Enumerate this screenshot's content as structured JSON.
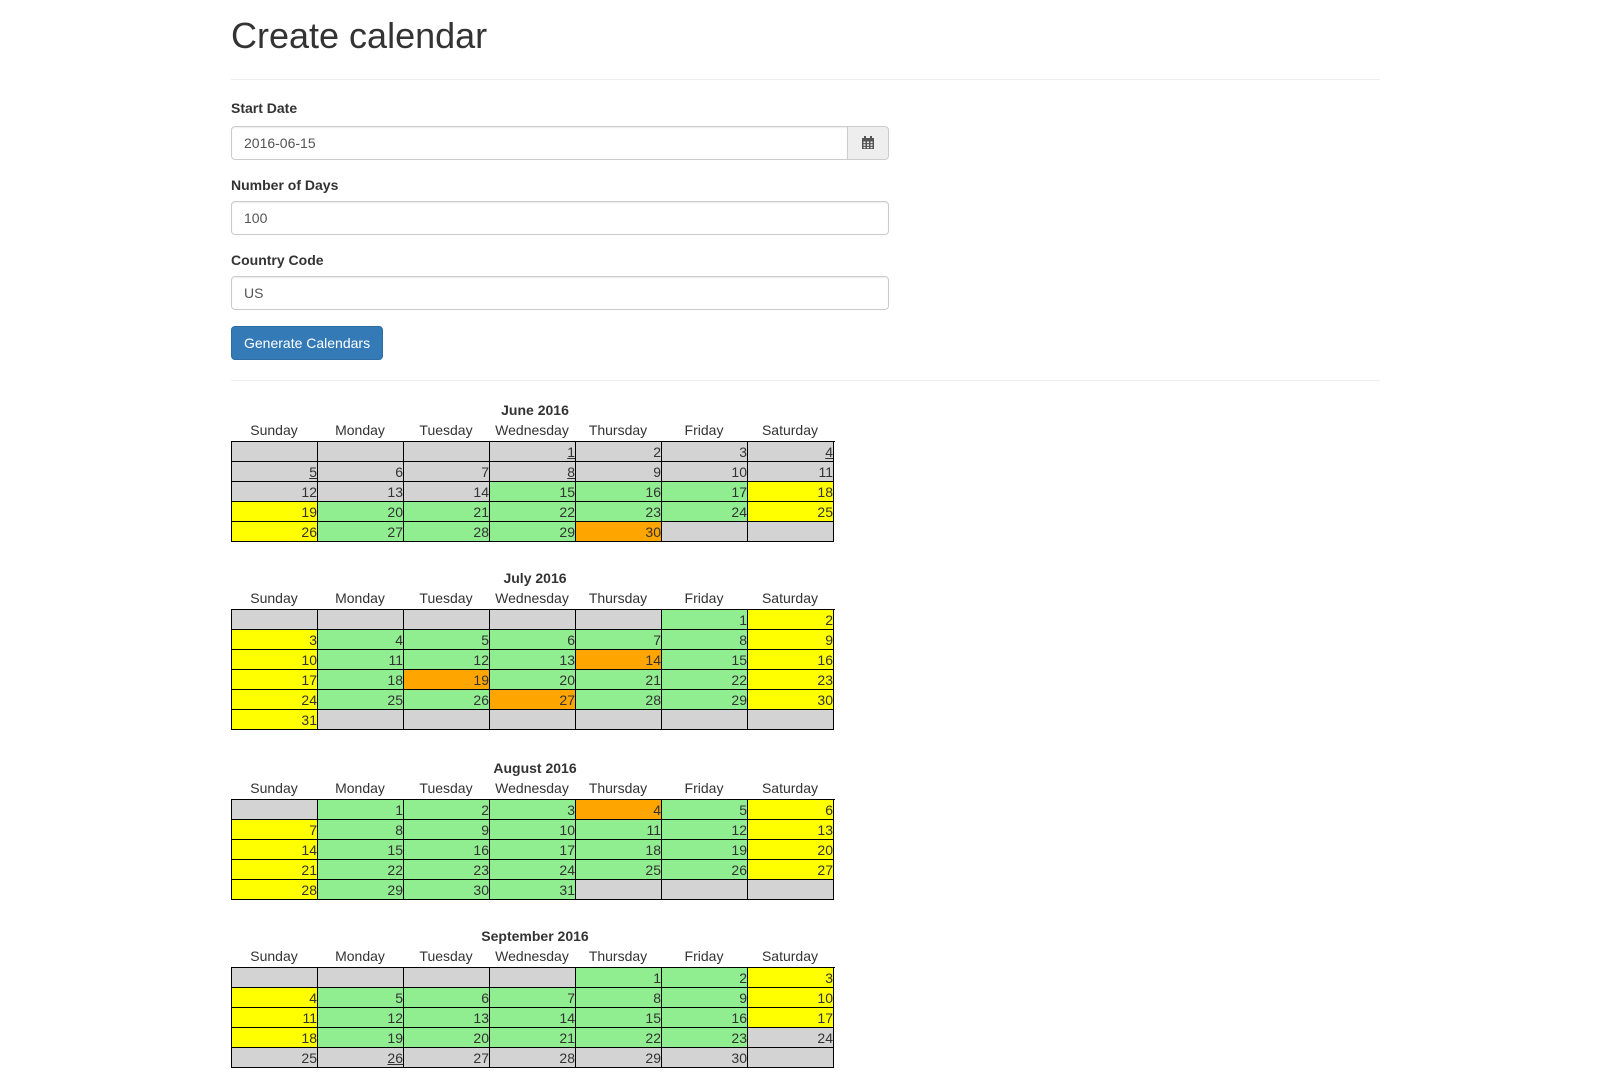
{
  "page": {
    "title": "Create calendar"
  },
  "form": {
    "start_date": {
      "label": "Start Date",
      "value": "2016-06-15"
    },
    "num_days": {
      "label": "Number of Days",
      "value": "100"
    },
    "country_code": {
      "label": "Country Code",
      "value": "US"
    },
    "submit_label": "Generate Calendars"
  },
  "day_names": [
    "Sunday",
    "Monday",
    "Tuesday",
    "Wednesday",
    "Thursday",
    "Friday",
    "Saturday"
  ],
  "colors": {
    "g": "#d3d3d3",
    "w": "#90ee90",
    "y": "#ffff00",
    "o": "#ffa500",
    "primary": "#337ab7"
  },
  "calendars": [
    {
      "title": "June 2016",
      "weeks": [
        [
          {
            "c": "g"
          },
          {
            "c": "g"
          },
          {
            "c": "g"
          },
          {
            "d": "1",
            "c": "g",
            "u": true
          },
          {
            "d": "2",
            "c": "g"
          },
          {
            "d": "3",
            "c": "g"
          },
          {
            "d": "4",
            "c": "g",
            "u": true
          }
        ],
        [
          {
            "d": "5",
            "c": "g",
            "u": true
          },
          {
            "d": "6",
            "c": "g"
          },
          {
            "d": "7",
            "c": "g"
          },
          {
            "d": "8",
            "c": "g",
            "u": true
          },
          {
            "d": "9",
            "c": "g"
          },
          {
            "d": "10",
            "c": "g"
          },
          {
            "d": "11",
            "c": "g"
          }
        ],
        [
          {
            "d": "12",
            "c": "g"
          },
          {
            "d": "13",
            "c": "g"
          },
          {
            "d": "14",
            "c": "g"
          },
          {
            "d": "15",
            "c": "w"
          },
          {
            "d": "16",
            "c": "w"
          },
          {
            "d": "17",
            "c": "w"
          },
          {
            "d": "18",
            "c": "y"
          }
        ],
        [
          {
            "d": "19",
            "c": "y"
          },
          {
            "d": "20",
            "c": "w"
          },
          {
            "d": "21",
            "c": "w"
          },
          {
            "d": "22",
            "c": "w"
          },
          {
            "d": "23",
            "c": "w"
          },
          {
            "d": "24",
            "c": "w"
          },
          {
            "d": "25",
            "c": "y"
          }
        ],
        [
          {
            "d": "26",
            "c": "y"
          },
          {
            "d": "27",
            "c": "w"
          },
          {
            "d": "28",
            "c": "w"
          },
          {
            "d": "29",
            "c": "w"
          },
          {
            "d": "30",
            "c": "o"
          },
          {
            "c": "g"
          },
          {
            "c": "g"
          }
        ]
      ]
    },
    {
      "title": "July 2016",
      "weeks": [
        [
          {
            "c": "g"
          },
          {
            "c": "g"
          },
          {
            "c": "g"
          },
          {
            "c": "g"
          },
          {
            "c": "g"
          },
          {
            "d": "1",
            "c": "w"
          },
          {
            "d": "2",
            "c": "y"
          }
        ],
        [
          {
            "d": "3",
            "c": "y"
          },
          {
            "d": "4",
            "c": "w"
          },
          {
            "d": "5",
            "c": "w"
          },
          {
            "d": "6",
            "c": "w"
          },
          {
            "d": "7",
            "c": "w"
          },
          {
            "d": "8",
            "c": "w"
          },
          {
            "d": "9",
            "c": "y"
          }
        ],
        [
          {
            "d": "10",
            "c": "y"
          },
          {
            "d": "11",
            "c": "w"
          },
          {
            "d": "12",
            "c": "w"
          },
          {
            "d": "13",
            "c": "w"
          },
          {
            "d": "14",
            "c": "o"
          },
          {
            "d": "15",
            "c": "w"
          },
          {
            "d": "16",
            "c": "y"
          }
        ],
        [
          {
            "d": "17",
            "c": "y"
          },
          {
            "d": "18",
            "c": "w"
          },
          {
            "d": "19",
            "c": "o"
          },
          {
            "d": "20",
            "c": "w"
          },
          {
            "d": "21",
            "c": "w"
          },
          {
            "d": "22",
            "c": "w"
          },
          {
            "d": "23",
            "c": "y"
          }
        ],
        [
          {
            "d": "24",
            "c": "y"
          },
          {
            "d": "25",
            "c": "w"
          },
          {
            "d": "26",
            "c": "w"
          },
          {
            "d": "27",
            "c": "o"
          },
          {
            "d": "28",
            "c": "w"
          },
          {
            "d": "29",
            "c": "w"
          },
          {
            "d": "30",
            "c": "y"
          }
        ],
        [
          {
            "d": "31",
            "c": "y"
          },
          {
            "c": "g"
          },
          {
            "c": "g"
          },
          {
            "c": "g"
          },
          {
            "c": "g"
          },
          {
            "c": "g"
          },
          {
            "c": "g"
          }
        ]
      ]
    },
    {
      "title": "August 2016",
      "weeks": [
        [
          {
            "c": "g"
          },
          {
            "d": "1",
            "c": "w"
          },
          {
            "d": "2",
            "c": "w"
          },
          {
            "d": "3",
            "c": "w"
          },
          {
            "d": "4",
            "c": "o"
          },
          {
            "d": "5",
            "c": "w"
          },
          {
            "d": "6",
            "c": "y"
          }
        ],
        [
          {
            "d": "7",
            "c": "y"
          },
          {
            "d": "8",
            "c": "w"
          },
          {
            "d": "9",
            "c": "w"
          },
          {
            "d": "10",
            "c": "w"
          },
          {
            "d": "11",
            "c": "w"
          },
          {
            "d": "12",
            "c": "w"
          },
          {
            "d": "13",
            "c": "y"
          }
        ],
        [
          {
            "d": "14",
            "c": "y"
          },
          {
            "d": "15",
            "c": "w"
          },
          {
            "d": "16",
            "c": "w"
          },
          {
            "d": "17",
            "c": "w"
          },
          {
            "d": "18",
            "c": "w"
          },
          {
            "d": "19",
            "c": "w"
          },
          {
            "d": "20",
            "c": "y"
          }
        ],
        [
          {
            "d": "21",
            "c": "y"
          },
          {
            "d": "22",
            "c": "w"
          },
          {
            "d": "23",
            "c": "w"
          },
          {
            "d": "24",
            "c": "w"
          },
          {
            "d": "25",
            "c": "w"
          },
          {
            "d": "26",
            "c": "w"
          },
          {
            "d": "27",
            "c": "y"
          }
        ],
        [
          {
            "d": "28",
            "c": "y"
          },
          {
            "d": "29",
            "c": "w"
          },
          {
            "d": "30",
            "c": "w"
          },
          {
            "d": "31",
            "c": "w"
          },
          {
            "c": "g"
          },
          {
            "c": "g"
          },
          {
            "c": "g"
          }
        ]
      ]
    },
    {
      "title": "September 2016",
      "weeks": [
        [
          {
            "c": "g"
          },
          {
            "c": "g"
          },
          {
            "c": "g"
          },
          {
            "c": "g"
          },
          {
            "d": "1",
            "c": "w"
          },
          {
            "d": "2",
            "c": "w"
          },
          {
            "d": "3",
            "c": "y"
          }
        ],
        [
          {
            "d": "4",
            "c": "y"
          },
          {
            "d": "5",
            "c": "w"
          },
          {
            "d": "6",
            "c": "w"
          },
          {
            "d": "7",
            "c": "w"
          },
          {
            "d": "8",
            "c": "w"
          },
          {
            "d": "9",
            "c": "w"
          },
          {
            "d": "10",
            "c": "y"
          }
        ],
        [
          {
            "d": "11",
            "c": "y"
          },
          {
            "d": "12",
            "c": "w"
          },
          {
            "d": "13",
            "c": "w"
          },
          {
            "d": "14",
            "c": "w"
          },
          {
            "d": "15",
            "c": "w"
          },
          {
            "d": "16",
            "c": "w"
          },
          {
            "d": "17",
            "c": "y"
          }
        ],
        [
          {
            "d": "18",
            "c": "y"
          },
          {
            "d": "19",
            "c": "w"
          },
          {
            "d": "20",
            "c": "w"
          },
          {
            "d": "21",
            "c": "w"
          },
          {
            "d": "22",
            "c": "w"
          },
          {
            "d": "23",
            "c": "w"
          },
          {
            "d": "24",
            "c": "g"
          }
        ],
        [
          {
            "d": "25",
            "c": "g"
          },
          {
            "d": "26",
            "c": "g",
            "u": true
          },
          {
            "d": "27",
            "c": "g"
          },
          {
            "d": "28",
            "c": "g"
          },
          {
            "d": "29",
            "c": "g"
          },
          {
            "d": "30",
            "c": "g"
          },
          {
            "c": "g"
          }
        ]
      ]
    }
  ]
}
